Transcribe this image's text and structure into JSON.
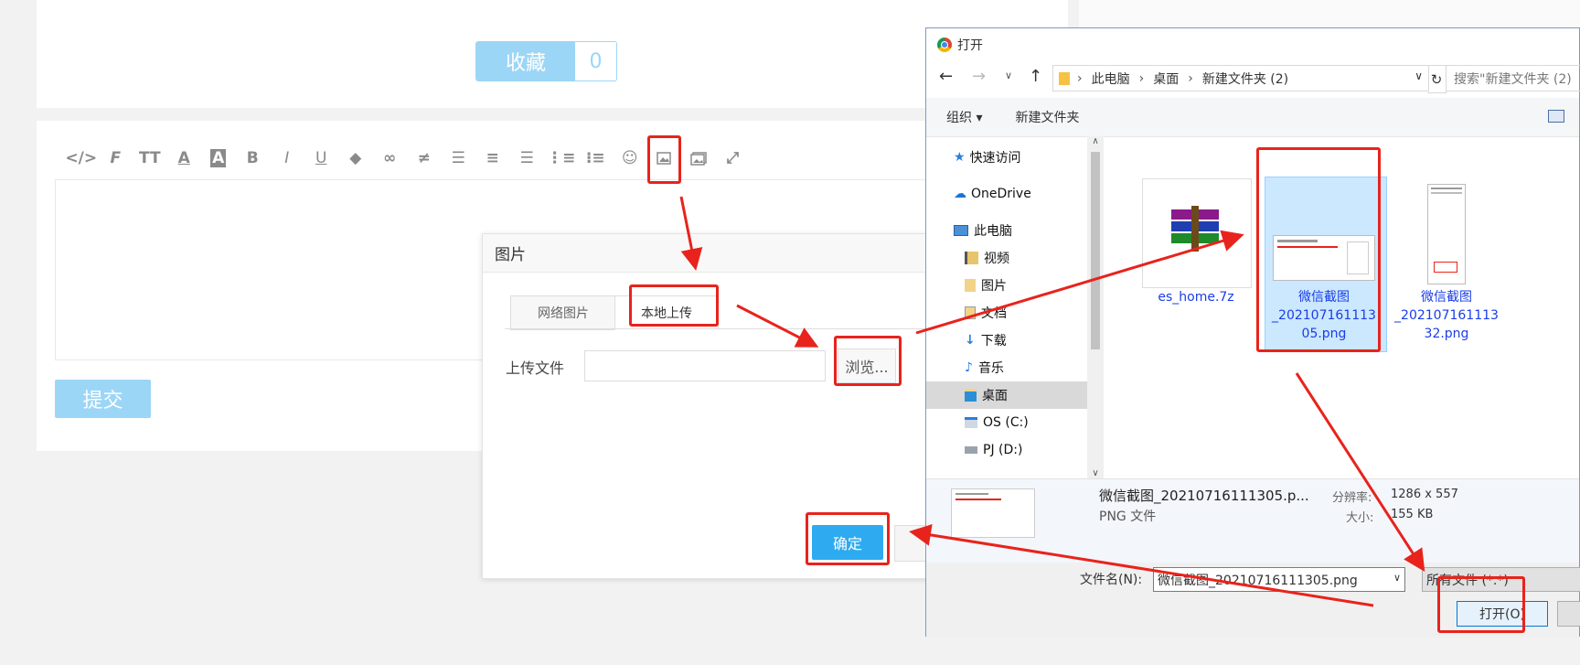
{
  "favorite": {
    "label": "收藏",
    "count": "0"
  },
  "editor": {
    "toolbar_icons": [
      "code-icon",
      "font-icon",
      "font-size-icon",
      "font-color-icon",
      "background-color-icon",
      "bold-icon",
      "italic-icon",
      "underline-icon",
      "eraser-icon",
      "link-icon",
      "unlink-icon",
      "align-left-icon",
      "align-center-icon",
      "align-right-icon",
      "ordered-list-icon",
      "unordered-list-icon",
      "emoji-icon",
      "image-icon",
      "multi-image-icon",
      "fullscreen-icon"
    ],
    "submit_label": "提交"
  },
  "image_dialog": {
    "title": "图片",
    "tabs": [
      "网络图片",
      "本地上传"
    ],
    "upload_label": "上传文件",
    "browse_label": "浏览...",
    "confirm_label": "确定"
  },
  "file_dialog": {
    "title": "打开",
    "breadcrumb": [
      "此电脑",
      "桌面",
      "新建文件夹 (2)"
    ],
    "search_placeholder": "搜索\"新建文件夹 (2)",
    "organize_label": "组织 ▾",
    "new_folder_label": "新建文件夹",
    "nav_items": [
      {
        "label": "快速访问",
        "icon": "star-icon"
      },
      {
        "label": "OneDrive",
        "icon": "cloud-icon"
      },
      {
        "label": "此电脑",
        "icon": "computer-icon"
      },
      {
        "label": "视频",
        "icon": "video-folder-icon"
      },
      {
        "label": "图片",
        "icon": "picture-folder-icon"
      },
      {
        "label": "文档",
        "icon": "document-folder-icon"
      },
      {
        "label": "下载",
        "icon": "download-folder-icon"
      },
      {
        "label": "音乐",
        "icon": "music-folder-icon"
      },
      {
        "label": "桌面",
        "icon": "desktop-folder-icon"
      },
      {
        "label": "OS (C:)",
        "icon": "drive-c-icon"
      },
      {
        "label": "PJ (D:)",
        "icon": "drive-d-icon"
      }
    ],
    "files": [
      {
        "name": "es_home.7z",
        "icon": "archive-icon"
      },
      {
        "name": "微信截图_20210716111305.png",
        "line1": "微信截图",
        "line2": "_202107161113",
        "line3": "05.png",
        "icon": "screenshot-thumbnail-icon"
      },
      {
        "name": "微信截图_20210716111332.png",
        "line1": "微信截图",
        "line2": "_202107161113",
        "line3": "32.png",
        "icon": "screenshot-thumbnail-icon"
      }
    ],
    "details": {
      "file_name": "微信截图_20210716111305.p...",
      "file_type": "PNG 文件",
      "resolution_label": "分辨率:",
      "resolution_value": "1286 x 557",
      "size_label": "大小:",
      "size_value": "155 KB"
    },
    "filename_label": "文件名(N):",
    "filename_value": "微信截图_20210716111305.png",
    "filetype_value": "所有文件 (*.*)",
    "open_label": "打开(O)"
  },
  "colors": {
    "accent": "#2eaaf0",
    "light_accent": "#9cd6f6",
    "highlight": "#e8231c",
    "link": "#1a3de8"
  }
}
